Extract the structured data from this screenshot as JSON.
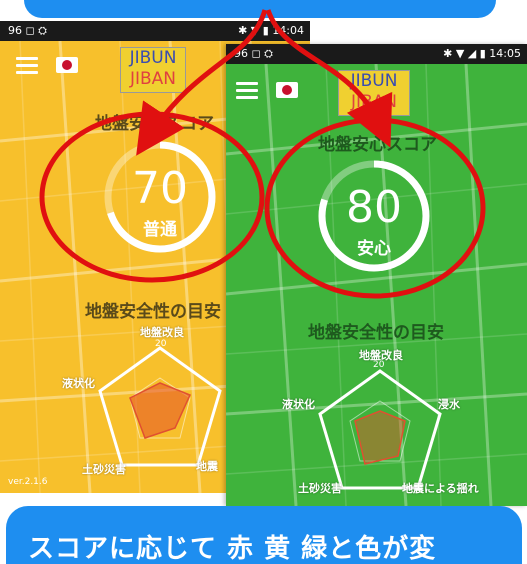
{
  "colors": {
    "banner": "#1e8ef0",
    "yellow_screen": "#f7c02c",
    "green_screen": "#3fb33c",
    "annotation_red": "#e01010"
  },
  "caption": "スコアに応じて 赤 黄 緑と色が変",
  "screen_yellow": {
    "status_left": "96 ◻ ⛭",
    "status_right": "✱ ▼ ▮ 14:04",
    "logo": {
      "line1": "JIBUN",
      "line2": "JIBAN"
    },
    "score_title": "地盤安心スコア",
    "score_value": "70",
    "score_label": "普通",
    "score_level": 0.7,
    "radar_title": "地盤安全性の目安",
    "radar_labels": {
      "top": "地盤改良",
      "left": "液状化",
      "bottom_left": "土砂災害",
      "bottom_right": "地震"
    },
    "radar_tick": "20",
    "version": "ver.2.1.6"
  },
  "screen_green": {
    "status_left": "96 ◻ ⛭",
    "status_right": "✱ ▼ ◢ ▮ 14:05",
    "logo": {
      "line1": "JIBUN",
      "line2": "JIBAN"
    },
    "score_title": "地盤安心スコア",
    "score_value": "80",
    "score_label": "安心",
    "score_level": 0.8,
    "radar_title": "地盤安全性の目安",
    "radar_labels": {
      "top": "地盤改良",
      "left": "液状化",
      "right": "浸水",
      "bottom_left": "土砂災害",
      "bottom_right": "地震による揺れ"
    },
    "radar_tick": "20"
  }
}
